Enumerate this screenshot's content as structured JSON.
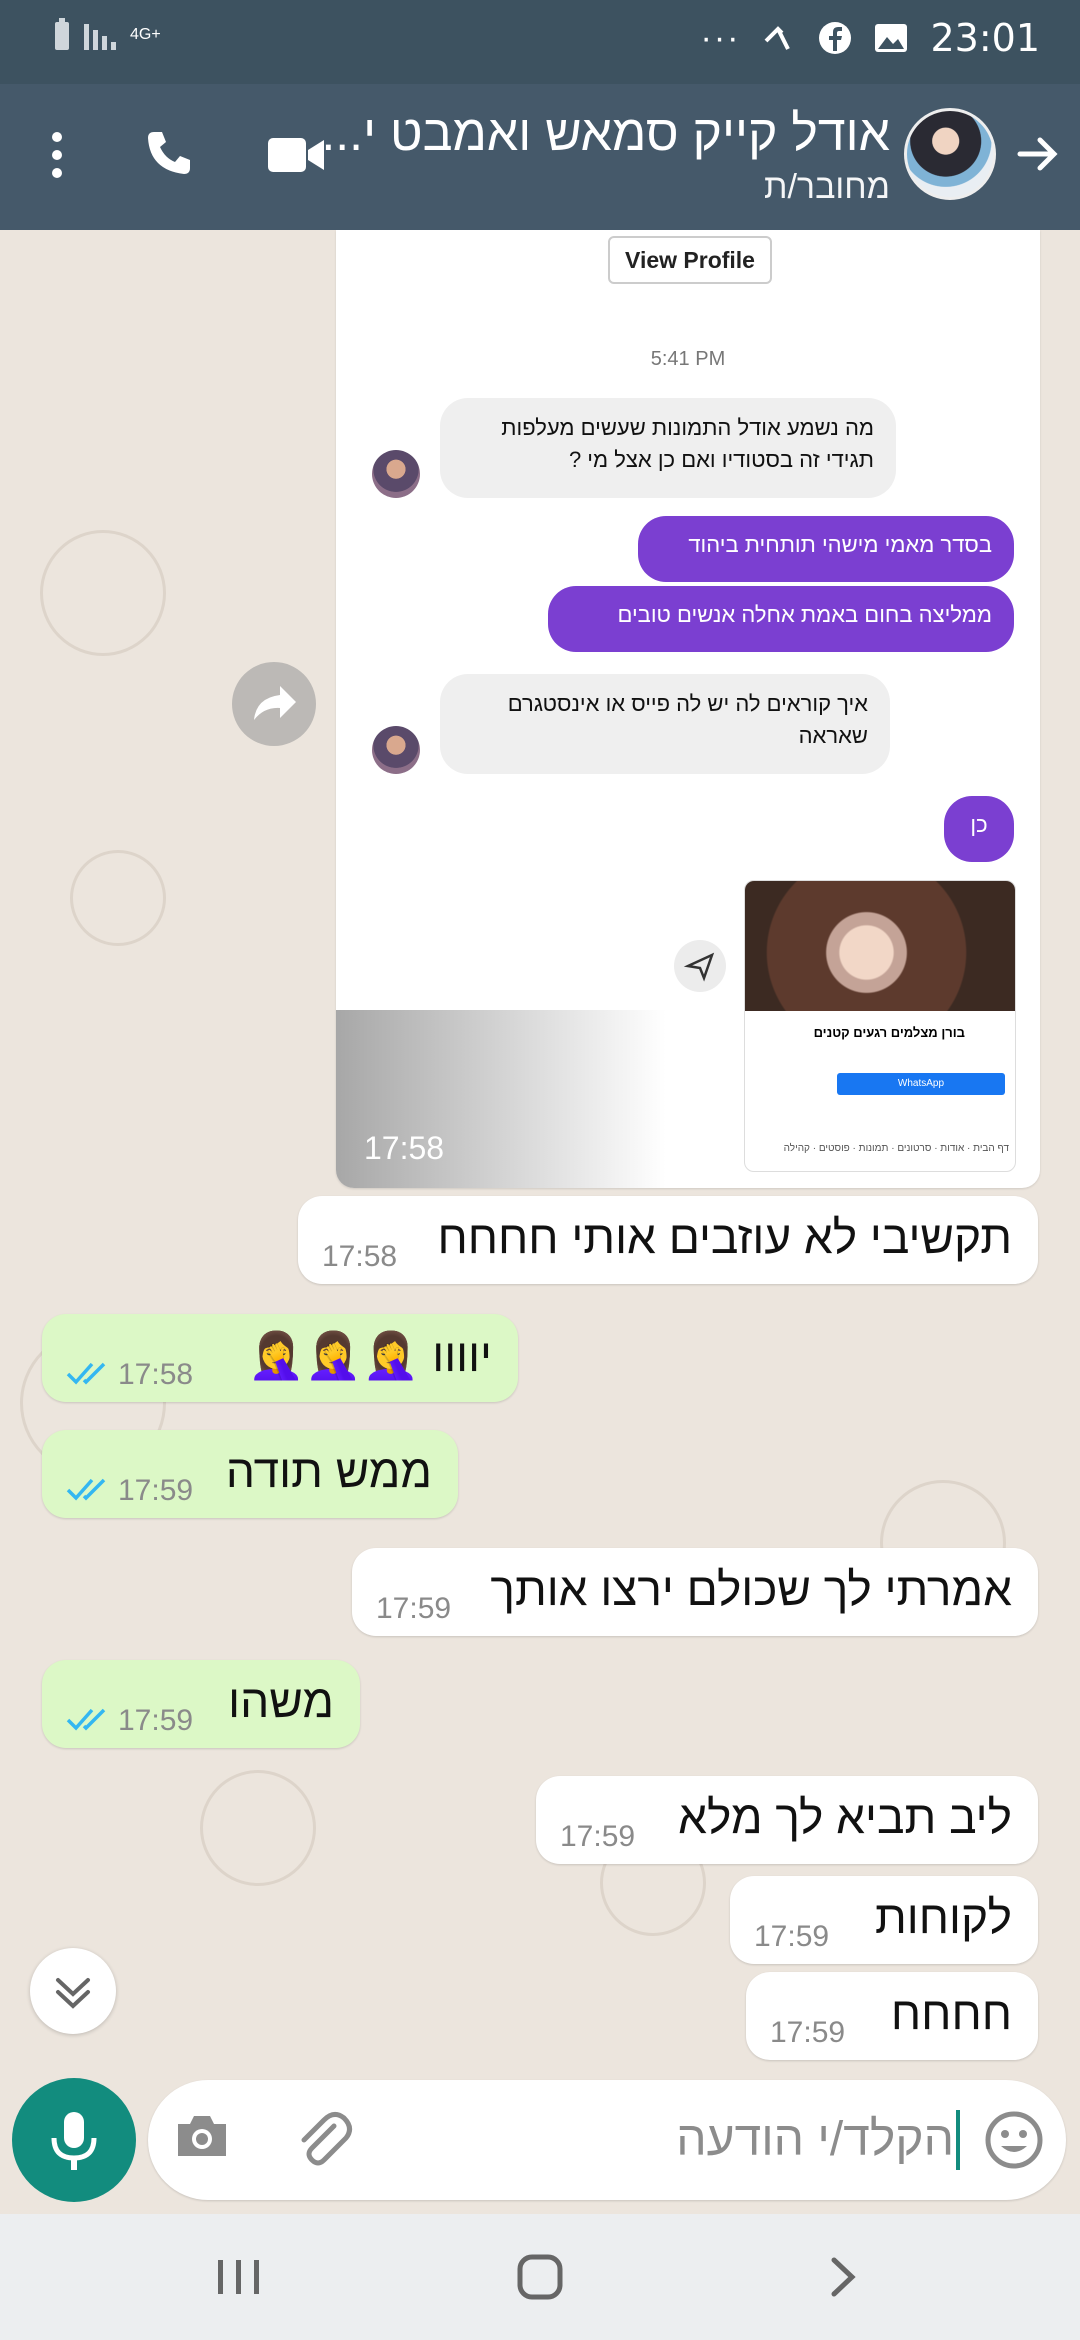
{
  "status_bar": {
    "network": "4G+",
    "time": "23:01",
    "overflow": "···",
    "icons": [
      "battery-icon",
      "signal-icon",
      "overflow-dots-icon",
      "phone-missed-icon",
      "facebook-icon",
      "gallery-icon"
    ]
  },
  "header": {
    "contact_name": "אודל קייק סמאש ואמבט י...",
    "status": "מחובר/ת",
    "icons": [
      "back-arrow-icon",
      "video-call-icon",
      "voice-call-icon",
      "more-vert-icon"
    ]
  },
  "shared_screenshot": {
    "view_profile": "View Profile",
    "time_label": "5:41 PM",
    "messages": [
      {
        "dir": "in",
        "text": "מה נשמע אודל התמונות שעשים מעלפות תגידי זה בסטודיו ואם כן אצל מי ?"
      },
      {
        "dir": "out",
        "text": "בסדר מאמי מישהי תותחית ביהוד"
      },
      {
        "dir": "out",
        "text": "ממליצה בחום באמת אחלה אנשים טובים"
      },
      {
        "dir": "in",
        "text": "איך קוראים לה יש לה פייס או אינסטגרם שאראה"
      },
      {
        "dir": "out",
        "text": "כן"
      }
    ],
    "fb_card": {
      "page_name": "בורן מצלמים רגעים קטנים",
      "whatsapp_button": "WhatsApp",
      "tabs": "דף הבית · אודות · סרטונים · תמונות · פוסטים · קהילה"
    },
    "sent_time": "17:58"
  },
  "messages": [
    {
      "dir": "in",
      "text": "תקשיבי לא עוזבים אותי חחחח",
      "time": "17:58"
    },
    {
      "dir": "out",
      "text": "יוווו 🤦‍♀️🤦‍♀️🤦‍♀️",
      "time": "17:58",
      "read": true
    },
    {
      "dir": "out",
      "text": "ממש תודה",
      "time": "17:59",
      "read": true
    },
    {
      "dir": "in",
      "text": "אמרתי לך שכולם ירצו אותך",
      "time": "17:59"
    },
    {
      "dir": "out",
      "text": "משהו",
      "time": "17:59",
      "read": true
    },
    {
      "dir": "in",
      "text": "ליב תביא לך מלא",
      "time": "17:59"
    },
    {
      "dir": "in",
      "text": "לקוחות",
      "time": "17:59"
    },
    {
      "dir": "in",
      "text": "חחחח",
      "time": "17:59"
    }
  ],
  "composer": {
    "placeholder": "הקלד/י הודעה",
    "icons": [
      "emoji-icon",
      "attach-icon",
      "camera-icon",
      "mic-icon"
    ]
  },
  "colors": {
    "header": "#45596a",
    "status_bar": "#3d5260",
    "outgoing_bubble": "#dcf8c6",
    "incoming_bubble": "#ffffff",
    "accent": "#128c7e",
    "read_ticks": "#34b7f1",
    "chat_background": "#ece5dd"
  }
}
